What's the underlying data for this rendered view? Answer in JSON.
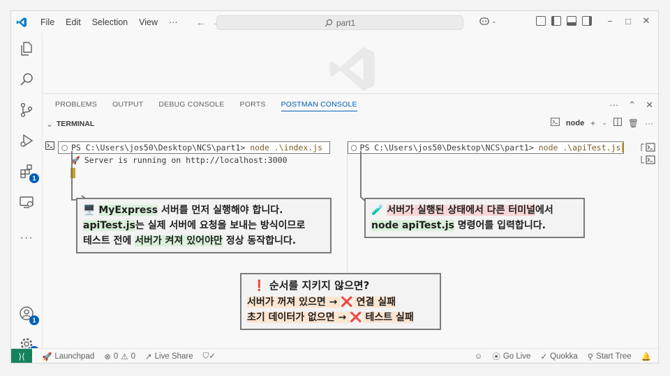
{
  "titlebar": {
    "menu": [
      "File",
      "Edit",
      "Selection",
      "View",
      "···"
    ],
    "search_text": "part1"
  },
  "panel": {
    "tabs": [
      "PROBLEMS",
      "OUTPUT",
      "DEBUG CONSOLE",
      "PORTS",
      "POSTMAN CONSOLE"
    ],
    "active_tab": "POSTMAN CONSOLE",
    "terminal_title": "TERMINAL",
    "shell_name": "node"
  },
  "terminal": {
    "pane1": {
      "prompt": "PS C:\\Users\\jos50\\Desktop\\NCS\\part1>",
      "command": "node .\\index.js",
      "output": "Server is running on http://localhost:3000"
    },
    "pane2": {
      "prompt": "PS C:\\Users\\jos50\\Desktop\\NCS\\part1>",
      "command": "node .\\apiTest.js"
    }
  },
  "activity": {
    "extensions_badge": "1",
    "accounts_badge": "1",
    "manage_badge": "1"
  },
  "callouts": {
    "c1": {
      "line1_a": "MyExpress",
      "line1_b": " 서버를 먼저 실행해야 합니다.",
      "line2_a": "apiTest.js",
      "line2_b": "는 실제 서버에 요청을 보내는 방식이므로",
      "line3_a": "테스트 전에 ",
      "line3_b": "서버가 켜져 있어야만",
      "line3_c": " 정상 동작합니다."
    },
    "c2": {
      "line1_a": "서버가 실행된 상태에서 ",
      "line1_b": "다른 터미널",
      "line1_c": "에서",
      "line2_a": "node apiTest.js",
      "line2_b": " 명령어를 입력합니다."
    },
    "c3": {
      "title": "순서를 지키지 않으면?",
      "line1_a": "서버가 꺼져 있으면 → ",
      "line1_b": " 연결 실패",
      "line2_a": "초기 데이터가 없으면 → ",
      "line2_b": " 테스트 실패"
    }
  },
  "statusbar": {
    "launchpad": "Launchpad",
    "errors": "0",
    "warnings": "0",
    "live_share": "Live Share",
    "go_live": "Go Live",
    "quokka": "Quokka",
    "start_tree": "Start Tree"
  },
  "colors": {
    "accent": "#005fb8",
    "remote": "#16825d",
    "highlight_green": "#d9f0d9",
    "highlight_pink": "#f9d6d6",
    "highlight_peach": "#fde5d0"
  }
}
